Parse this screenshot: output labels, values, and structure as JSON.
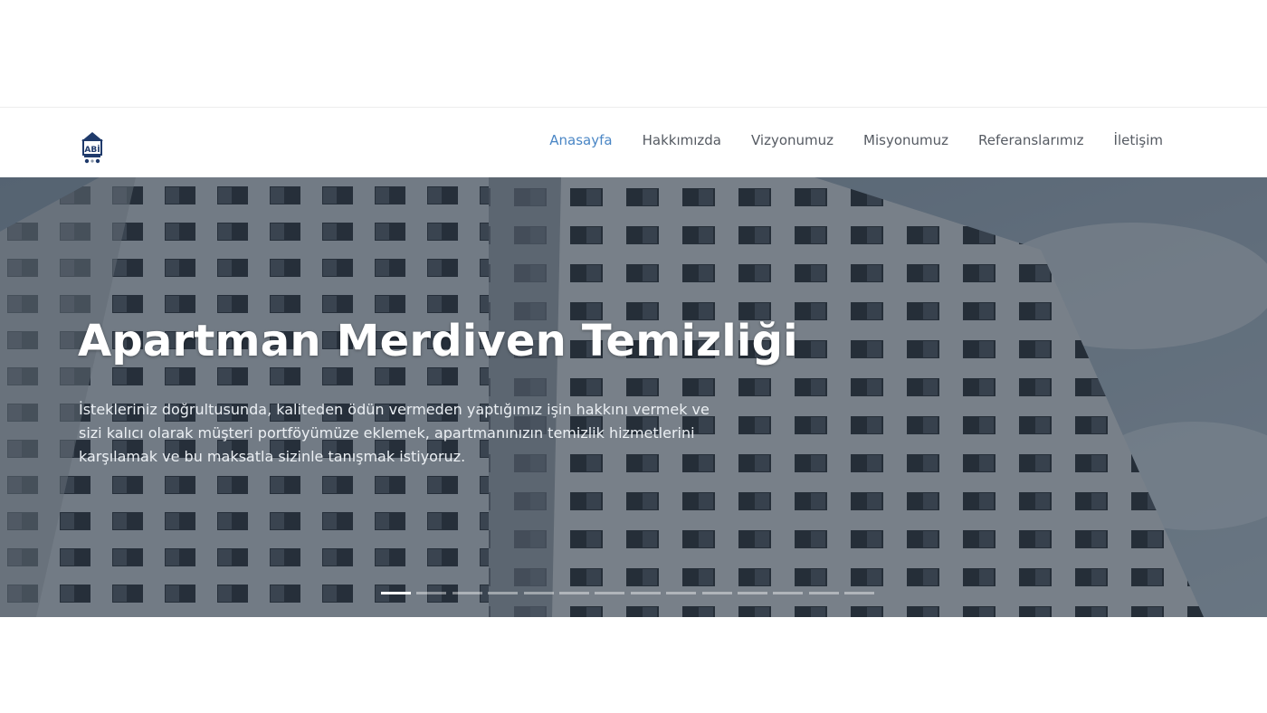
{
  "brand": {
    "logo_icon": "building-logo-icon",
    "logo_text": "ABİ"
  },
  "nav": {
    "items": [
      {
        "label": "Anasayfa",
        "active": true
      },
      {
        "label": "Hakkımızda",
        "active": false
      },
      {
        "label": "Vizyonumuz",
        "active": false
      },
      {
        "label": "Misyonumuz",
        "active": false
      },
      {
        "label": "Referanslarımız",
        "active": false
      },
      {
        "label": "İletişim",
        "active": false
      }
    ],
    "active_color": "#4a86c5",
    "text_color": "#555a62"
  },
  "hero": {
    "title": "Apartman Merdiven Temizliği",
    "text": "İstekleriniz doğrultusunda, kaliteden ödün vermeden yaptığımız işin hakkını vermek ve sizi kalıcı olarak müşteri portföyümüze eklemek, apartmanınızın temizlik hizmetlerini karşılamak ve bu maksatla sizinle tanışmak istiyoruz.",
    "slide_count": 14,
    "active_slide": 1
  }
}
